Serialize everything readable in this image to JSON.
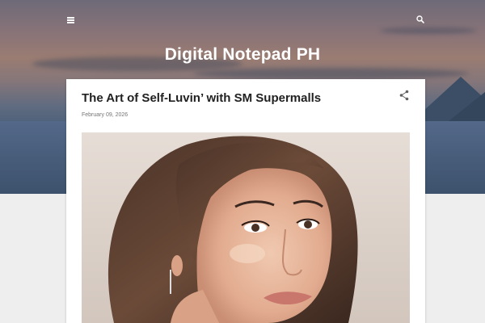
{
  "header": {
    "site_title": "Digital Notepad PH",
    "menu_icon": "menu-icon",
    "search_icon": "search-icon"
  },
  "post": {
    "title": "The Art of Self-Luvin’ with SM Supermalls",
    "date": "February 09, 2026",
    "share_icon": "share-icon",
    "image_alt": "Portrait of a woman with short brown hair"
  },
  "colors": {
    "page_background": "#eeeeee",
    "card_background": "#ffffff",
    "title_text": "#212121",
    "date_text": "#757575"
  }
}
